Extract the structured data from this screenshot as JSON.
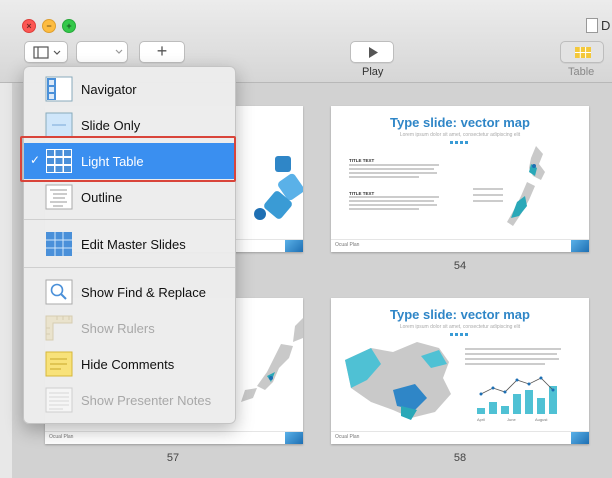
{
  "window": {
    "title": "D"
  },
  "toolbar": {
    "play_label": "Play",
    "table_label": "Table",
    "add_symbol": "+"
  },
  "menu": {
    "items": [
      {
        "label": "Navigator",
        "enabled": true
      },
      {
        "label": "Slide Only",
        "enabled": true
      },
      {
        "label": "Light Table",
        "enabled": true,
        "selected": true
      },
      {
        "label": "Outline",
        "enabled": true
      },
      {
        "label": "Edit Master Slides",
        "enabled": true
      },
      {
        "label": "Show Find & Replace",
        "enabled": true
      },
      {
        "label": "Show Rulers",
        "enabled": false
      },
      {
        "label": "Hide Comments",
        "enabled": true
      },
      {
        "label": "Show Presenter Notes",
        "enabled": false
      }
    ],
    "checkmark": "✓"
  },
  "slides": {
    "s54": {
      "title": "Type slide: vector map",
      "subtitle": "Lorem ipsum dolor sit amet, consectetur adipiscing elit",
      "number": "54",
      "label1": "TITLE TEXT",
      "label2": "TITLE TEXT"
    },
    "s58": {
      "title": "Type slide: vector map",
      "subtitle": "Lorem ipsum dolor sit amet, consectetur adipiscing elit",
      "number": "58"
    },
    "s57": {
      "number": "57"
    },
    "footer_brand": "Ocual Plan",
    "chart_months": [
      "April",
      "June",
      "August"
    ]
  },
  "colors": {
    "accent": "#3a8ff0",
    "slide_title": "#2f86c7",
    "highlight": "#d9443a"
  }
}
